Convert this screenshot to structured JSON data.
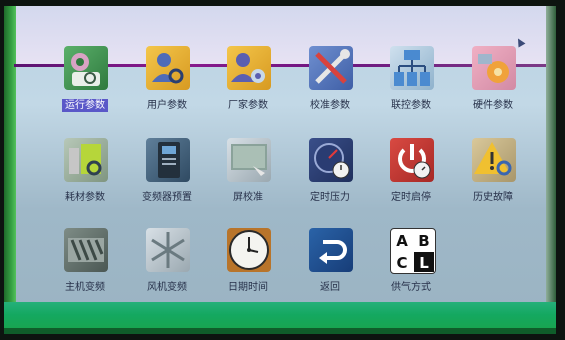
{
  "menu": {
    "row1": [
      {
        "label": "运行参数",
        "icon": "gear-magnifier-icon",
        "selected": true
      },
      {
        "label": "用户参数",
        "icon": "user-search-icon",
        "selected": false
      },
      {
        "label": "厂家参数",
        "icon": "user-settings-icon",
        "selected": false
      },
      {
        "label": "校准参数",
        "icon": "tools-wrench-icon",
        "selected": false
      },
      {
        "label": "联控参数",
        "icon": "network-link-icon",
        "selected": false
      },
      {
        "label": "硬件参数",
        "icon": "hardware-gear-icon",
        "selected": false
      }
    ],
    "row2": [
      {
        "label": "耗材参数",
        "icon": "consumables-icon"
      },
      {
        "label": "变频器预置",
        "icon": "inverter-icon"
      },
      {
        "label": "屏校准",
        "icon": "screen-calibrate-icon"
      },
      {
        "label": "定时压力",
        "icon": "pressure-timer-icon"
      },
      {
        "label": "定时启停",
        "icon": "power-timer-icon"
      },
      {
        "label": "历史故障",
        "icon": "warning-search-icon"
      }
    ],
    "row3": [
      {
        "label": "主机变频",
        "icon": "screw-rotor-icon"
      },
      {
        "label": "风机变频",
        "icon": "fan-icon"
      },
      {
        "label": "日期时间",
        "icon": "clock-icon"
      },
      {
        "label": "返回",
        "icon": "return-arrow-icon"
      },
      {
        "label": "供气方式",
        "icon": "abcl-icon"
      }
    ]
  },
  "abcl": [
    "A",
    "B",
    "C",
    "L"
  ],
  "colors": {
    "selected_bg": "#5a58c8",
    "label": "#27314a",
    "screen_bg": "#bcd3e2"
  }
}
